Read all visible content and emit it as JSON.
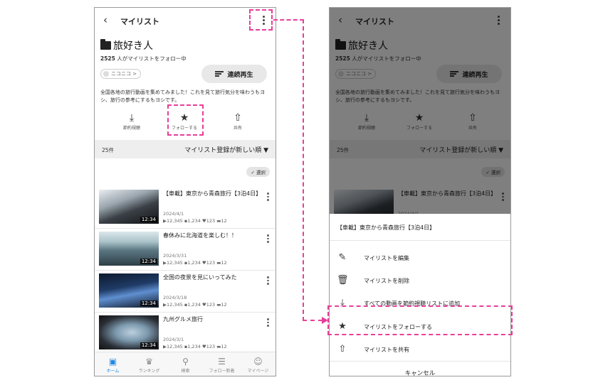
{
  "header": {
    "back_glyph": "‹",
    "title": "マイリスト"
  },
  "mylist": {
    "name": "旅好き人",
    "followers_count": "2525",
    "followers_suffix": " 人がマイリストをフォロー中",
    "owner_chip": "ニコニコ >",
    "play_all_label": "連続再生",
    "description": "全国各地の旅行動画を集めてみました！これを見て旅行気分を味わうもヨシ、旅行の参考にするもヨシです。"
  },
  "actions": [
    {
      "label": "節約視聴",
      "icon": "download-icon",
      "glyph": "⤓"
    },
    {
      "label": "フォローする",
      "icon": "star-icon",
      "glyph": "★"
    },
    {
      "label": "共有",
      "icon": "share-icon",
      "glyph": "⇧"
    }
  ],
  "list": {
    "count": "25件",
    "sort_label": "マイリスト登録が新しい順 ▼",
    "select_label": "✓ 選択"
  },
  "videos": [
    {
      "title": "【車載】東京から青森旅行【3泊4日】",
      "date": "2024/4/1",
      "duration": "12:34",
      "views": "▶12,345",
      "comments": "▪1,234",
      "likes": "♥123",
      "mylists": "▬12"
    },
    {
      "title": "春休みに北海道を楽しむ！！",
      "date": "2024/3/31",
      "duration": "12:34",
      "views": "▶12,345",
      "comments": "▪1,234",
      "likes": "♥123",
      "mylists": "▬12"
    },
    {
      "title": "全国の夜景を見にいってみた",
      "date": "2024/3/18",
      "duration": "12:34",
      "views": "▶12,345",
      "comments": "▪1,234",
      "likes": "♥123",
      "mylists": "▬12"
    },
    {
      "title": "九州グルメ旅行",
      "date": "2024/3/1",
      "duration": "12:34",
      "views": "▶12,345",
      "comments": "▪1,234",
      "likes": "♥123",
      "mylists": "▬12"
    }
  ],
  "tabs": [
    {
      "label": "ホーム",
      "icon": "home-tv-icon",
      "glyph": "▣",
      "active": true
    },
    {
      "label": "ランキング",
      "icon": "crown-icon",
      "glyph": "♛",
      "active": false
    },
    {
      "label": "検索",
      "icon": "search-icon",
      "glyph": "⚲",
      "active": false
    },
    {
      "label": "フォロー新着",
      "icon": "feed-icon",
      "glyph": "☰",
      "active": false
    },
    {
      "label": "マイページ",
      "icon": "user-icon",
      "glyph": "☺",
      "active": false
    }
  ],
  "sheet": {
    "title": "【車載】東京から青森旅行【3泊4日】",
    "items": [
      {
        "label": "マイリストを編集",
        "icon": "edit-icon",
        "glyph": "✎"
      },
      {
        "label": "マイリストを削除",
        "icon": "trash-icon",
        "glyph": "🗑"
      },
      {
        "label": "すべての動画を節約視聴リストに追加",
        "icon": "download-icon",
        "glyph": "⤓"
      },
      {
        "label": "マイリストをフォローする",
        "icon": "star-icon",
        "glyph": "★"
      },
      {
        "label": "マイリストを共有",
        "icon": "share-icon",
        "glyph": "⇧"
      }
    ],
    "cancel_label": "キャンセル"
  },
  "colors": {
    "accent": "#1e88e5",
    "highlight": "#e83e9a"
  }
}
